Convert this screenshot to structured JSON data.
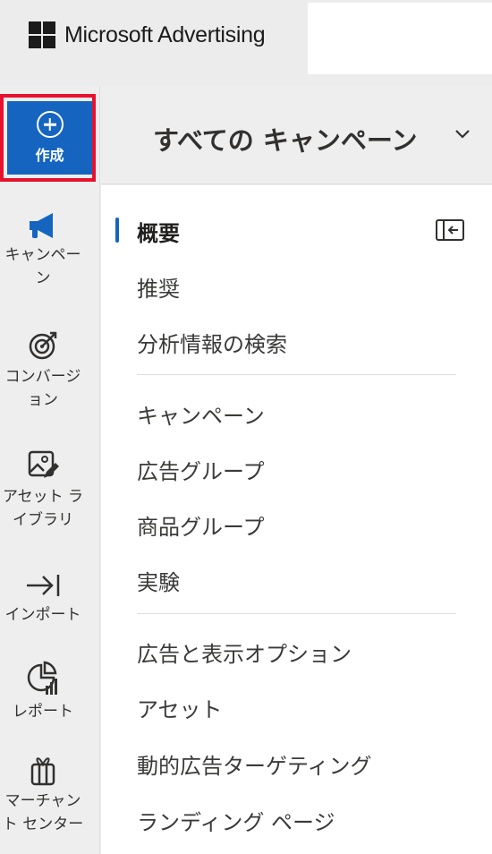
{
  "header": {
    "brand": "Microsoft Advertising",
    "logo_icon": "microsoft-logo-icon"
  },
  "rail": {
    "create_label": "作成",
    "items": [
      {
        "label_lines": [
          "キャンペー",
          "ン"
        ],
        "icon": "megaphone-icon"
      },
      {
        "label_lines": [
          "コンバージ",
          "ョン"
        ],
        "icon": "target-icon"
      },
      {
        "label_lines": [
          "アセット ラ",
          "イブラリ"
        ],
        "icon": "image-edit-icon"
      },
      {
        "label_lines": [
          "インポート"
        ],
        "icon": "import-arrow-icon"
      },
      {
        "label_lines": [
          "レポート"
        ],
        "icon": "report-chart-icon"
      },
      {
        "label_lines": [
          "マーチャン",
          "ト センター"
        ],
        "icon": "gift-icon"
      }
    ]
  },
  "campaign_selector": {
    "title": "すべての キャンペーン",
    "icon": "chevron-down-icon"
  },
  "nav": {
    "items": [
      {
        "label": "概要",
        "active": true
      },
      {
        "label": "推奨"
      },
      {
        "label": "分析情報の検索"
      },
      {
        "label": "キャンペーン"
      },
      {
        "label": "広告グループ"
      },
      {
        "label": "商品グループ"
      },
      {
        "label": "実験"
      },
      {
        "label": "広告と表示オプション"
      },
      {
        "label": "アセット"
      },
      {
        "label": "動的広告ターゲティング"
      },
      {
        "label": "ランディング ページ"
      }
    ],
    "collapse_icon": "collapse-panel-icon"
  },
  "colors": {
    "accent": "#1565c0",
    "highlight": "#e8112d"
  }
}
